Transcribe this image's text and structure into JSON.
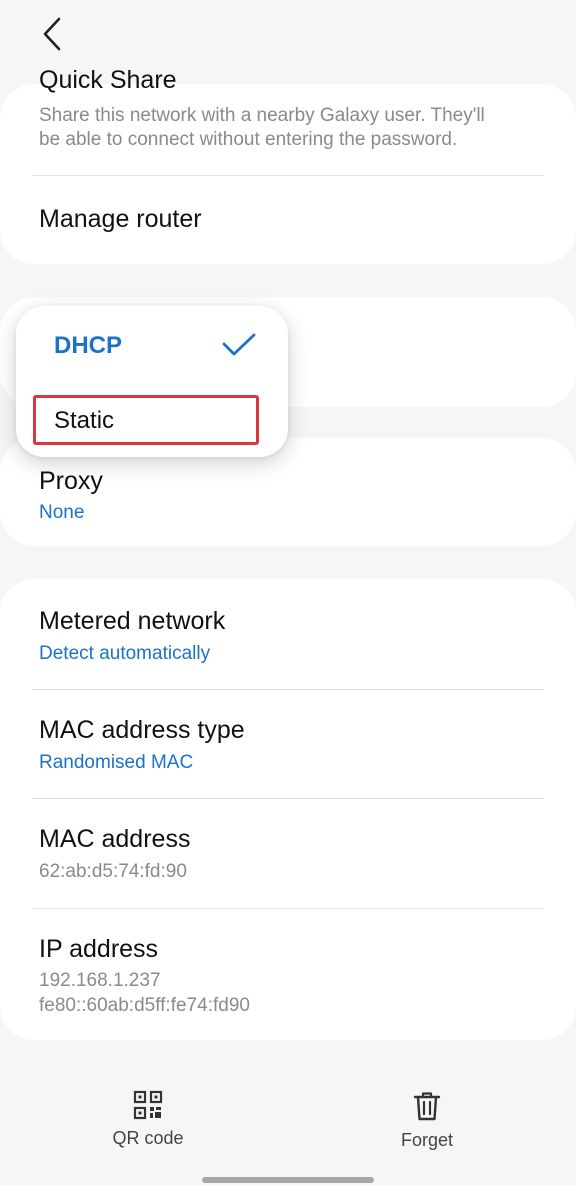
{
  "header": {
    "back_icon": "chevron-left-icon"
  },
  "quick_share": {
    "title": "Quick Share",
    "description_line1": "Share this network with a nearby Galaxy user. They'll",
    "description_line2": "be able to connect without entering the password."
  },
  "manage_router": {
    "title": "Manage router"
  },
  "ip_settings_menu": {
    "options": [
      {
        "label": "DHCP",
        "selected": true
      },
      {
        "label": "Static",
        "selected": false
      }
    ],
    "check_icon": "checkmark-icon"
  },
  "proxy": {
    "title": "Proxy",
    "value": "None"
  },
  "metered_network": {
    "title": "Metered network",
    "value": "Detect automatically"
  },
  "mac_address_type": {
    "title": "MAC address type",
    "value": "Randomised MAC"
  },
  "mac_address": {
    "title": "MAC address",
    "value": "62:ab:d5:74:fd:90"
  },
  "ip_address": {
    "title": "IP address",
    "value_v4": "192.168.1.237",
    "value_v6": "fe80::60ab:d5ff:fe74:fd90"
  },
  "bottom_bar": {
    "qr_code": {
      "label": "QR code",
      "icon": "qr-code-icon"
    },
    "forget": {
      "label": "Forget",
      "icon": "trash-icon"
    }
  },
  "colors": {
    "accent": "#1a73c8",
    "highlight": "#d9363e",
    "background": "#f6f6f6"
  }
}
